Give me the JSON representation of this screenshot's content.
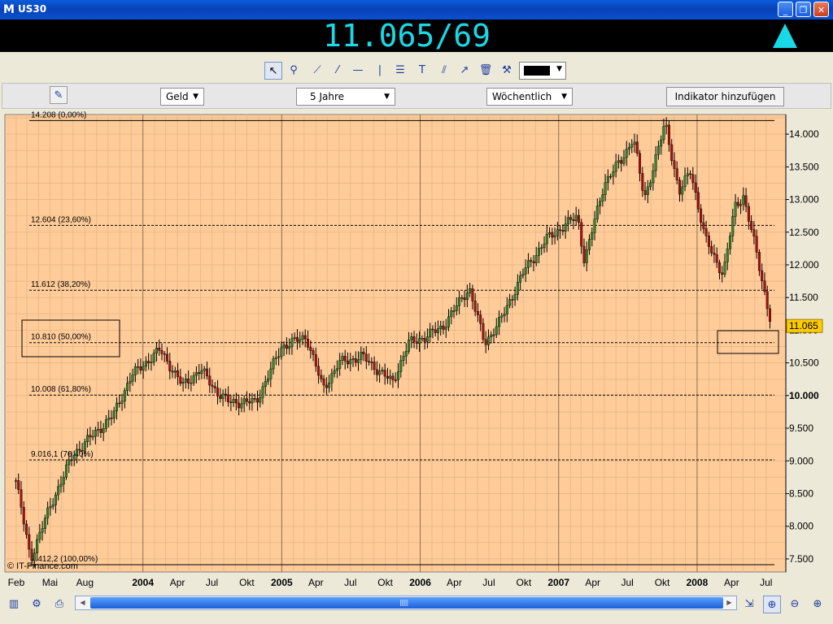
{
  "window": {
    "title": "US30",
    "app_icon": "M"
  },
  "price_display": {
    "value": "11.065/69",
    "direction_icon": "arrow-up-icon"
  },
  "toolbar": {
    "tools": [
      "select-cursor-icon",
      "zoom-magnifier-icon",
      "trendline-icon",
      "ray-line-icon",
      "horizontal-line-icon",
      "vertical-line-icon",
      "fibonacci-icon",
      "text-tool-icon",
      "parallel-channel-icon",
      "arrow-line-icon",
      "trash-icon",
      "tools-icon"
    ],
    "color_picker_value": "#000000"
  },
  "controls": {
    "price_type": "Geld",
    "range": "5 Jahre",
    "interval": "Wöchentlich",
    "add_indicator_label": "Indikator hinzufügen"
  },
  "chart_data": {
    "type": "candlestick",
    "background": "#ffcc99",
    "frequency": "weekly",
    "ylim": [
      7300,
      14300
    ],
    "y_ticks": [
      "7.500",
      "8.000",
      "8.500",
      "9.000",
      "9.500",
      "10.000",
      "10.500",
      "11.000",
      "11.500",
      "12.000",
      "12.500",
      "13.000",
      "13.500",
      "14.000"
    ],
    "y_tick_values": [
      7500,
      8000,
      8500,
      9000,
      9500,
      10000,
      10500,
      11000,
      11500,
      12000,
      12500,
      13000,
      13500,
      14000
    ],
    "x_ticks": [
      "Feb",
      "Mai",
      "Aug",
      "2004",
      "Apr",
      "Jul",
      "Okt",
      "2005",
      "Apr",
      "Jul",
      "Okt",
      "2006",
      "Apr",
      "Jul",
      "Okt",
      "2007",
      "Apr",
      "Jul",
      "Okt",
      "2008",
      "Apr",
      "Jul"
    ],
    "x_tick_dates": [
      "2003-02",
      "2003-05",
      "2003-08",
      "2004-01",
      "2004-04",
      "2004-07",
      "2004-10",
      "2005-01",
      "2005-04",
      "2005-07",
      "2005-10",
      "2006-01",
      "2006-04",
      "2006-07",
      "2006-10",
      "2007-01",
      "2007-04",
      "2007-07",
      "2007-10",
      "2008-01",
      "2008-04",
      "2008-07"
    ],
    "current_value_label": "11.065",
    "current_value": 11065,
    "fibonacci_levels": [
      {
        "label": "14.208 (0,00%)",
        "value": 14208
      },
      {
        "label": "12.604 (23,60%)",
        "value": 12604
      },
      {
        "label": "11.612 (38,20%)",
        "value": 11612
      },
      {
        "label": "10.810 (50,00%)",
        "value": 10810
      },
      {
        "label": "10.008 (61,80%)",
        "value": 10008
      },
      {
        "label": "9.016,1 (76,40%)",
        "value": 9016
      },
      {
        "label": "7.412,2 (100,00%)",
        "value": 7412
      }
    ],
    "series": [
      {
        "dates": [
          "2003-01-31",
          "2003-03-11",
          "2003-05-01",
          "2003-07-01",
          "2003-09-01",
          "2003-10-15",
          "2003-12-01",
          "2004-02-15",
          "2004-04-15",
          "2004-06-01",
          "2004-07-15",
          "2004-08-15",
          "2004-10-25",
          "2005-01-01",
          "2005-03-07",
          "2005-04-20",
          "2005-06-01",
          "2005-08-01",
          "2005-10-20",
          "2005-12-01",
          "2006-01-15",
          "2006-03-01",
          "2006-05-10",
          "2006-06-20",
          "2006-08-01",
          "2006-10-01",
          "2006-12-01",
          "2007-02-20",
          "2007-03-10",
          "2007-05-01",
          "2007-06-15",
          "2007-07-17",
          "2007-08-15",
          "2007-10-09",
          "2007-11-15",
          "2007-12-15",
          "2008-01-22",
          "2008-03-10",
          "2008-04-10",
          "2008-05-02",
          "2008-06-05",
          "2008-07-15"
        ],
        "close": [
          8700,
          7500,
          8300,
          9100,
          9450,
          9700,
          10300,
          10700,
          10150,
          10400,
          10050,
          9900,
          9900,
          10750,
          10900,
          10100,
          10500,
          10600,
          10200,
          10800,
          10900,
          11050,
          11650,
          10800,
          11150,
          11900,
          12400,
          12750,
          12050,
          13250,
          13600,
          13950,
          13000,
          14165,
          13100,
          13450,
          12400,
          11850,
          12900,
          13050,
          12200,
          11065
        ]
      }
    ],
    "annotations": [
      "© IT-Finance.com"
    ]
  }
}
